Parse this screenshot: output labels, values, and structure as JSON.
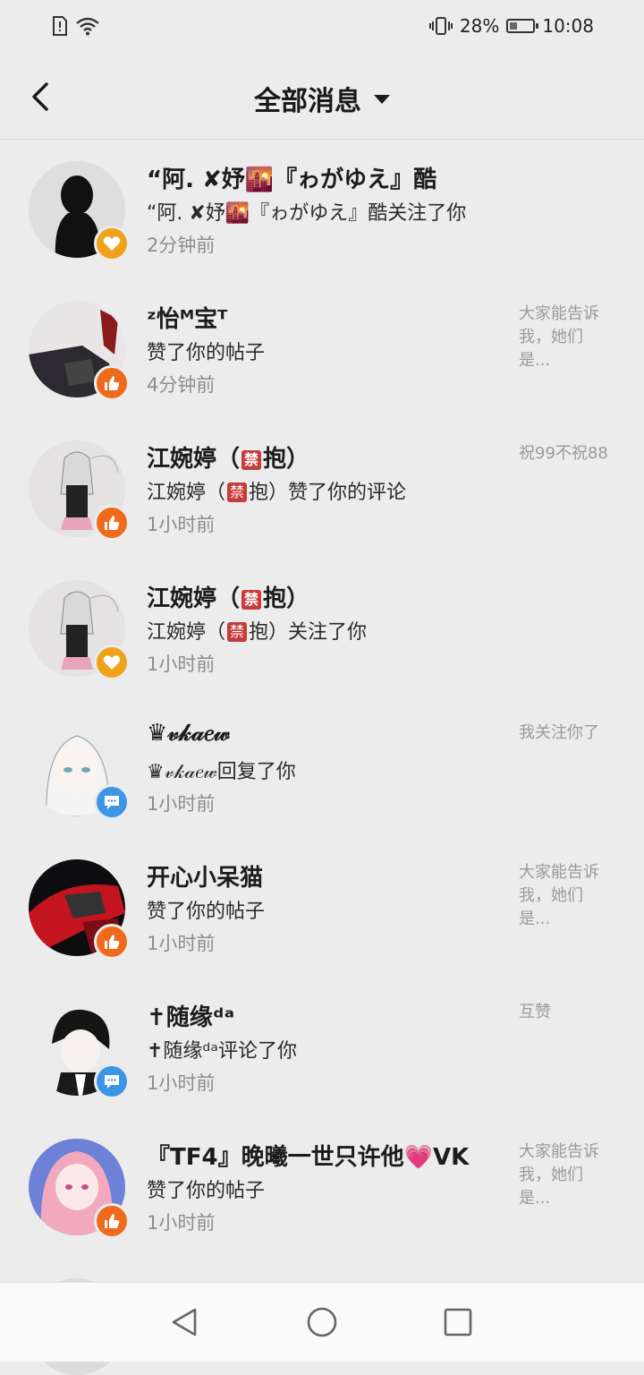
{
  "status_bar": {
    "battery": "28%",
    "time": "10:08"
  },
  "header": {
    "title": "全部消息"
  },
  "messages": [
    {
      "name": "“阿. ✘妤🌇『ゎがゆえ』酷",
      "action": "“阿. ✘妤🌇『ゎがゆえ』酷关注了你",
      "time": "2分钟前",
      "preview": "",
      "badge": "heart-icon"
    },
    {
      "name": "ᶻ怡ᴹ宝ᵀ",
      "action": "赞了你的帖子",
      "time": "4分钟前",
      "preview": "大家能告诉我，她们是...",
      "badge": "thumbs-up-icon"
    },
    {
      "name_prefix": "江婉婷（",
      "name_tag": "禁",
      "name_suffix": "抱）",
      "action_prefix": "江婉婷（",
      "action_tag": "禁",
      "action_suffix": "抱）赞了你的评论",
      "time": "1小时前",
      "preview": "祝99不祝88",
      "badge": "thumbs-up-icon"
    },
    {
      "name_prefix": "江婉婷（",
      "name_tag": "禁",
      "name_suffix": "抱）",
      "action_prefix": "江婉婷（",
      "action_tag": "禁",
      "action_suffix": "抱）关注了你",
      "time": "1小时前",
      "preview": "",
      "badge": "heart-icon"
    },
    {
      "name": "♛𝓋𝓀𝒶𝑒𝓌",
      "action": "♛𝓋𝓀𝒶𝑒𝓌回复了你",
      "time": "1小时前",
      "preview": "我关注你了",
      "badge": "comment-icon"
    },
    {
      "name": "开心小呆猫",
      "action": "赞了你的帖子",
      "time": "1小时前",
      "preview": "大家能告诉我，她们是...",
      "badge": "thumbs-up-icon"
    },
    {
      "name": "✝随缘ᵈᵃ",
      "action": "✝随缘ᵈᵃ评论了你",
      "time": "1小时前",
      "preview": "互赞",
      "badge": "comment-icon"
    },
    {
      "name": "『TF4』晚曦一世只许他💗VK",
      "action": "赞了你的帖子",
      "time": "1小时前",
      "preview": "大家能告诉我，她们是...",
      "badge": "thumbs-up-icon"
    }
  ],
  "colors": {
    "background": "#ececec",
    "like_badge": "#ef6a1c",
    "heart_badge": "#f0a21b",
    "comment_badge": "#3d95e6"
  }
}
